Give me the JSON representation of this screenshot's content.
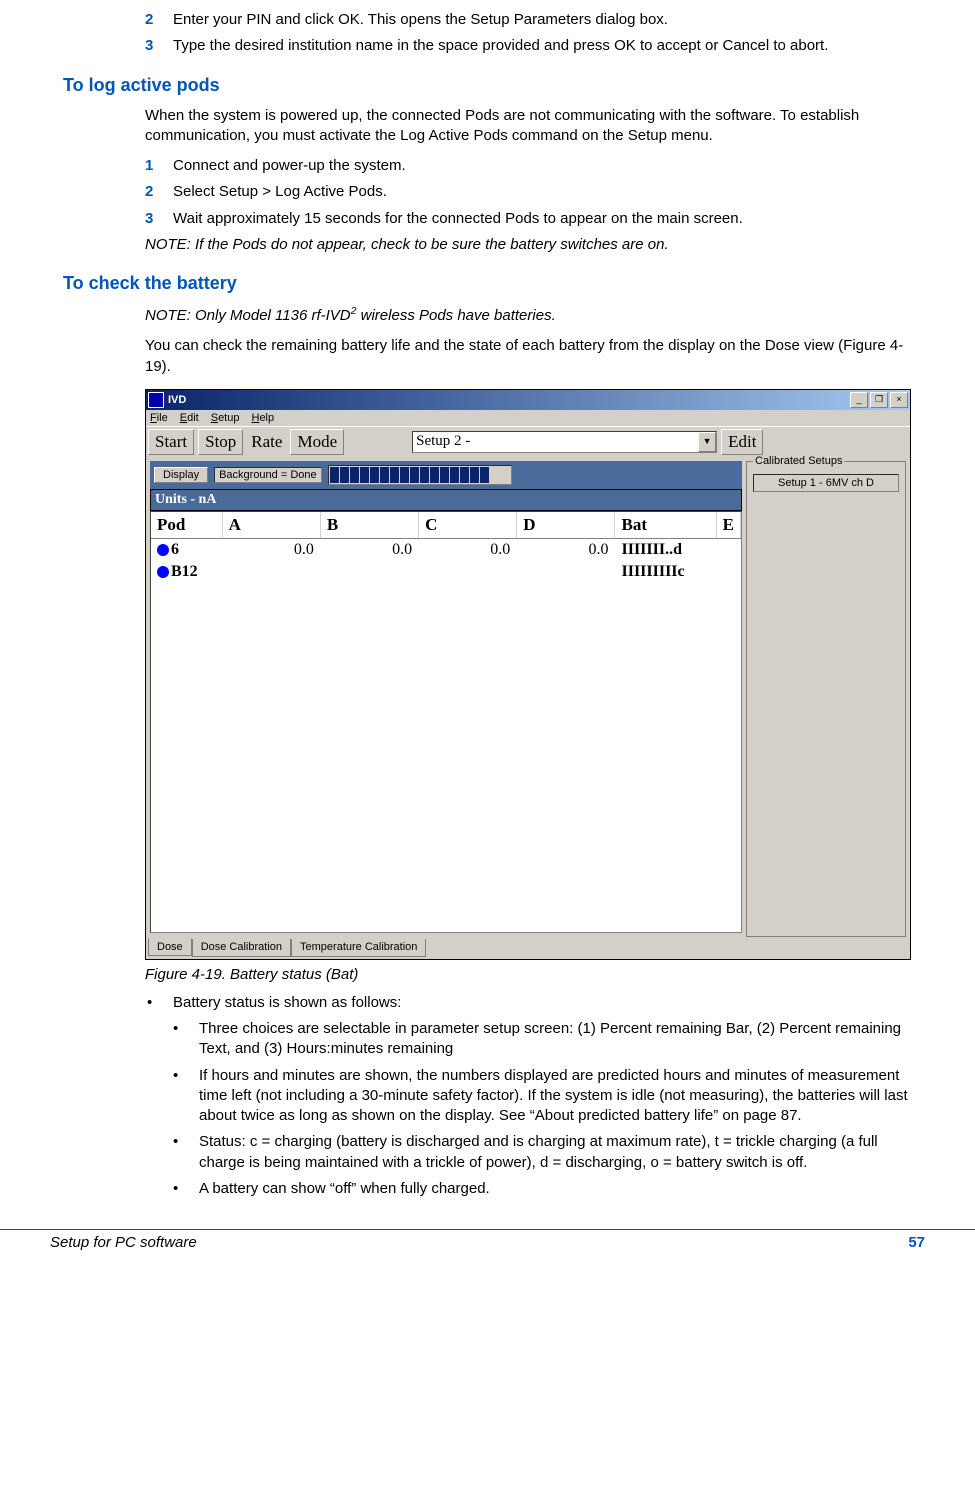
{
  "steps_top": [
    {
      "n": "2",
      "t": "Enter your PIN and click OK. This opens the Setup Parameters dialog box."
    },
    {
      "n": "3",
      "t": "Type the desired institution name in the space provided and press OK to accept or Cancel to abort."
    }
  ],
  "h1": "To log active pods",
  "p1": "When the system is powered up, the connected Pods are not communicating with the software. To establish communication, you must activate the Log Active Pods command on the Setup menu.",
  "steps_log": [
    {
      "n": "1",
      "t": "Connect and power-up the system."
    },
    {
      "n": "2",
      "t": "Select Setup > Log Active Pods."
    },
    {
      "n": "3",
      "t": "Wait approximately 15 seconds for the connected Pods to appear on the main screen."
    }
  ],
  "note1": "NOTE: If the Pods do not appear, check to be sure the battery switches are on.",
  "h2": "To check the battery",
  "note2_pre": "NOTE: Only Model 1136 rf-IVD",
  "note2_sup": "2",
  "note2_post": " wireless Pods have batteries.",
  "p2": "You can check the remaining battery life and the state of each battery from the display on the Dose view (Figure 4-19).",
  "fig": {
    "app_title": "IVD",
    "menus": [
      "File",
      "Edit",
      "Setup",
      "Help"
    ],
    "tb": {
      "start": "Start",
      "stop": "Stop",
      "rate": "Rate",
      "mode": "Mode",
      "combo": "Setup 2 -",
      "edit": "Edit"
    },
    "display_btn": "Display",
    "bg_text": "Background = Done",
    "units": "Units - nA",
    "cols": [
      "Pod",
      "A",
      "B",
      "C",
      "D",
      "Bat",
      "E"
    ],
    "rows": [
      {
        "pod": "6",
        "a": "0.0",
        "b": "0.0",
        "c": "0.0",
        "d": "0.0",
        "bat": "IIIIIII..d",
        "e": ""
      },
      {
        "pod": "B12",
        "a": "",
        "b": "",
        "c": "",
        "d": "",
        "bat": "IIIIIIIIIc",
        "e": ""
      }
    ],
    "side_title": "Calibrated Setups",
    "side_entry": "Setup 1 - 6MV ch D",
    "tabs": [
      "Dose",
      "Dose Calibration",
      "Temperature Calibration"
    ]
  },
  "caption": "Figure 4-19. Battery status (Bat)",
  "bullets": {
    "top": "Battery status is shown as follows:",
    "subs": [
      "Three choices are selectable in parameter setup screen: (1) Percent remaining Bar, (2) Percent remaining Text, and (3) Hours:minutes remaining",
      "If hours and minutes are shown, the numbers displayed are predicted hours and minutes of measurement time left (not including a 30-minute safety factor). If the system is idle (not measuring), the batteries will last about twice as long as shown on the display. See “About predicted battery life” on page 87.",
      "Status: c = charging (battery is discharged and is charging at maximum rate), t = trickle charging (a full charge is being maintained with a trickle of power), d = discharging, o = battery switch is off.",
      "A battery can show “off” when fully charged."
    ]
  },
  "footer": {
    "left": "Setup for PC software",
    "right": "57"
  }
}
